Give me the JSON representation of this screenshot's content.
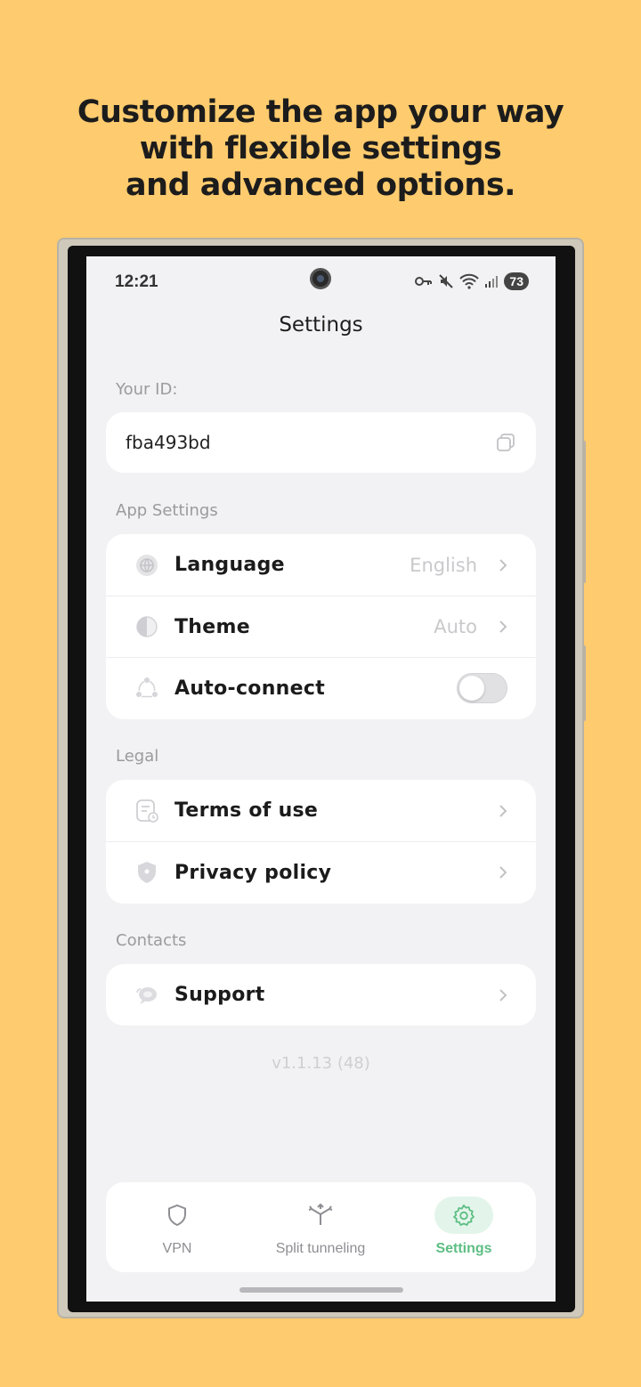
{
  "headline": {
    "line1": "Customize the app your way",
    "line2": "with flexible settings",
    "line3": "and advanced options."
  },
  "status_bar": {
    "time": "12:21",
    "battery": "73",
    "icons": [
      "vpn-key-icon",
      "mute-icon",
      "wifi-icon",
      "signal-icon"
    ]
  },
  "header": {
    "title": "Settings"
  },
  "id_section": {
    "label": "Your ID:",
    "value": "fba493bd",
    "copy_icon": "copy-icon"
  },
  "app_settings": {
    "label": "App Settings",
    "items": [
      {
        "label": "Language",
        "value": "English",
        "icon": "globe-icon"
      },
      {
        "label": "Theme",
        "value": "Auto",
        "icon": "contrast-icon"
      },
      {
        "label": "Auto-connect",
        "toggle": false,
        "icon": "nodes-icon"
      }
    ]
  },
  "legal": {
    "label": "Legal",
    "items": [
      {
        "label": "Terms of use",
        "icon": "document-clock-icon"
      },
      {
        "label": "Privacy policy",
        "icon": "shield-icon"
      }
    ]
  },
  "contacts": {
    "label": "Contacts",
    "items": [
      {
        "label": "Support",
        "icon": "chat-icon"
      }
    ]
  },
  "version": "v1.1.13 (48)",
  "tabbar": {
    "tabs": [
      {
        "label": "VPN",
        "icon": "shield-outline-icon",
        "active": false
      },
      {
        "label": "Split tunneling",
        "icon": "split-arrows-icon",
        "active": false
      },
      {
        "label": "Settings",
        "icon": "gear-icon",
        "active": true
      }
    ]
  },
  "colors": {
    "background": "#FECB6E",
    "screen": "#F2F2F4",
    "accent": "#5DBE83",
    "muted_text": "#9a9a9f"
  }
}
